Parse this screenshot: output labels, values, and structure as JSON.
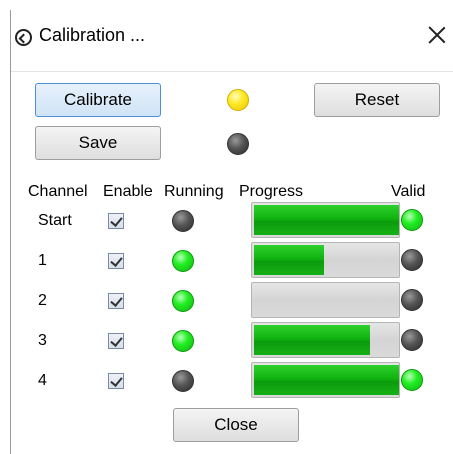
{
  "window": {
    "title": "Calibration ...",
    "app_icon": "back-circle-icon",
    "close_icon": "close-icon"
  },
  "controls": {
    "calibrate_label": "Calibrate",
    "reset_label": "Reset",
    "save_label": "Save",
    "calibrate_status_led": "yellow",
    "save_status_led": "gray"
  },
  "table": {
    "headers": [
      "Channel",
      "Enable",
      "Running",
      "Progress",
      "Valid"
    ],
    "rows": [
      {
        "channel": "Start",
        "enabled": true,
        "running": "gray",
        "progress": 1.0,
        "valid": "green"
      },
      {
        "channel": "1",
        "enabled": true,
        "running": "green",
        "progress": 0.48,
        "valid": "gray"
      },
      {
        "channel": "2",
        "enabled": true,
        "running": "green",
        "progress": 0.0,
        "valid": "gray"
      },
      {
        "channel": "3",
        "enabled": true,
        "running": "green",
        "progress": 0.8,
        "valid": "gray"
      },
      {
        "channel": "4",
        "enabled": true,
        "running": "gray",
        "progress": 1.0,
        "valid": "green"
      }
    ]
  },
  "footer": {
    "close_label": "Close"
  },
  "colors": {
    "led_green": "#22ee22",
    "led_gray": "#555555",
    "led_yellow": "#ffeb2a",
    "progress_fill": "#0fb40f",
    "focus_border": "#4d8fd6"
  }
}
